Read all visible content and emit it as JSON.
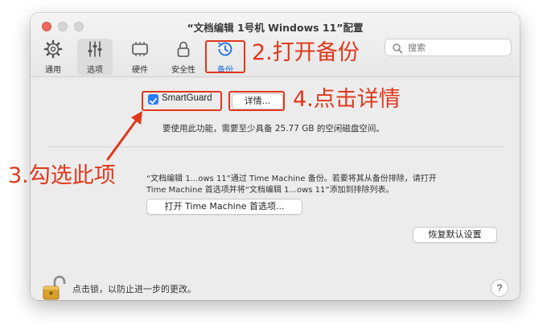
{
  "window": {
    "title": "“文档编辑 1号机 Windows 11”配置"
  },
  "toolbar": {
    "items": [
      {
        "label": "通用",
        "icon": "gear-icon"
      },
      {
        "label": "选项",
        "icon": "sliders-icon"
      },
      {
        "label": "硬件",
        "icon": "chip-icon"
      },
      {
        "label": "安全性",
        "icon": "lock-icon"
      },
      {
        "label": "备份",
        "icon": "clock-history-icon"
      }
    ],
    "selected": "选项",
    "search_placeholder": "搜索"
  },
  "backup": {
    "smartguard_label": "SmartGuard",
    "smartguard_checked": true,
    "details_button": "详情...",
    "disk_note": "要使用此功能，需要至少具备 25.77 GB 的空闲磁盘空间。",
    "exclusion_line1": "“文档编辑 1...ows 11”通过 Time Machine 备份。若要将其从备份排除，请打开",
    "exclusion_line2": "Time Machine 首选项并将“文档编辑 1...ows 11”添加到排除列表。",
    "open_tm_button": "打开 Time Machine 首选项...",
    "restore_defaults_button": "恢复默认设置"
  },
  "footer": {
    "lock_text": "点击锁，以防止进一步的更改。",
    "help_label": "?"
  },
  "annotations": {
    "step2": "2.打开备份",
    "step3": "3.勾选此项",
    "step4": "4.点击详情",
    "color": "#e0381c"
  },
  "colors": {
    "accent": "#2f7cf6",
    "window_bg": "#ececec"
  }
}
